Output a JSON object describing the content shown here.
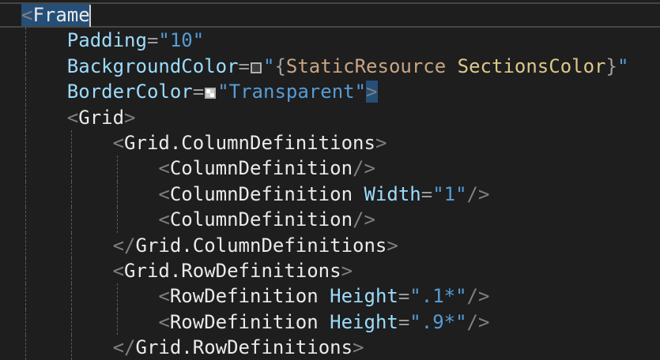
{
  "editor": {
    "lines": [
      {
        "indent": 0,
        "current": true,
        "guides": [],
        "tokens": [
          [
            "bracket",
            "<",
            true
          ],
          [
            "tag",
            "Frame",
            true
          ],
          [
            "cursor",
            ""
          ]
        ]
      },
      {
        "indent": 4,
        "guides": [
          0
        ],
        "tokens": [
          [
            "attr",
            "Padding"
          ],
          [
            "eq",
            "="
          ],
          [
            "str",
            "\"10\""
          ]
        ]
      },
      {
        "indent": 4,
        "guides": [
          0
        ],
        "tokens": [
          [
            "attr",
            "BackgroundColor"
          ],
          [
            "eq",
            "="
          ],
          [
            "swatch-dark",
            ""
          ],
          [
            "str",
            "\""
          ],
          [
            "brace",
            "{"
          ],
          [
            "ext",
            "StaticResource"
          ],
          [
            "sp",
            " "
          ],
          [
            "res",
            "SectionsColor"
          ],
          [
            "brace",
            "}"
          ],
          [
            "str",
            "\""
          ]
        ]
      },
      {
        "indent": 4,
        "guides": [
          0
        ],
        "tokens": [
          [
            "attr",
            "BorderColor"
          ],
          [
            "eq",
            "="
          ],
          [
            "swatch-transparent",
            ""
          ],
          [
            "str",
            "\"Transparent\""
          ],
          [
            "bracket",
            ">",
            true
          ]
        ]
      },
      {
        "indent": 4,
        "guides": [
          0
        ],
        "tokens": [
          [
            "bracket",
            "<"
          ],
          [
            "tag",
            "Grid"
          ],
          [
            "bracket",
            ">"
          ]
        ]
      },
      {
        "indent": 8,
        "guides": [
          0,
          4
        ],
        "tokens": [
          [
            "bracket",
            "<"
          ],
          [
            "tag",
            "Grid.ColumnDefinitions"
          ],
          [
            "bracket",
            ">"
          ]
        ]
      },
      {
        "indent": 12,
        "guides": [
          0,
          4,
          8
        ],
        "tokens": [
          [
            "bracket",
            "<"
          ],
          [
            "tag",
            "ColumnDefinition"
          ],
          [
            "bracket",
            "/>"
          ]
        ]
      },
      {
        "indent": 12,
        "guides": [
          0,
          4,
          8
        ],
        "tokens": [
          [
            "bracket",
            "<"
          ],
          [
            "tag",
            "ColumnDefinition"
          ],
          [
            "sp",
            " "
          ],
          [
            "attr",
            "Width"
          ],
          [
            "eq",
            "="
          ],
          [
            "str",
            "\"1\""
          ],
          [
            "bracket",
            "/>"
          ]
        ]
      },
      {
        "indent": 12,
        "guides": [
          0,
          4,
          8
        ],
        "tokens": [
          [
            "bracket",
            "<"
          ],
          [
            "tag",
            "ColumnDefinition"
          ],
          [
            "bracket",
            "/>"
          ]
        ]
      },
      {
        "indent": 8,
        "guides": [
          0,
          4
        ],
        "tokens": [
          [
            "bracket",
            "</"
          ],
          [
            "tag",
            "Grid.ColumnDefinitions"
          ],
          [
            "bracket",
            ">"
          ]
        ]
      },
      {
        "indent": 8,
        "guides": [
          0,
          4
        ],
        "tokens": [
          [
            "bracket",
            "<"
          ],
          [
            "tag",
            "Grid.RowDefinitions"
          ],
          [
            "bracket",
            ">"
          ]
        ]
      },
      {
        "indent": 12,
        "guides": [
          0,
          4,
          8
        ],
        "tokens": [
          [
            "bracket",
            "<"
          ],
          [
            "tag",
            "RowDefinition"
          ],
          [
            "sp",
            " "
          ],
          [
            "attr",
            "Height"
          ],
          [
            "eq",
            "="
          ],
          [
            "str",
            "\".1*\""
          ],
          [
            "bracket",
            "/>"
          ]
        ]
      },
      {
        "indent": 12,
        "guides": [
          0,
          4,
          8
        ],
        "tokens": [
          [
            "bracket",
            "<"
          ],
          [
            "tag",
            "RowDefinition"
          ],
          [
            "sp",
            " "
          ],
          [
            "attr",
            "Height"
          ],
          [
            "eq",
            "="
          ],
          [
            "str",
            "\".9*\""
          ],
          [
            "bracket",
            "/>"
          ]
        ]
      },
      {
        "indent": 8,
        "guides": [
          0,
          4
        ],
        "tokens": [
          [
            "bracket",
            "</"
          ],
          [
            "tag",
            "Grid.RowDefinitions"
          ],
          [
            "bracket",
            ">"
          ]
        ]
      }
    ]
  }
}
